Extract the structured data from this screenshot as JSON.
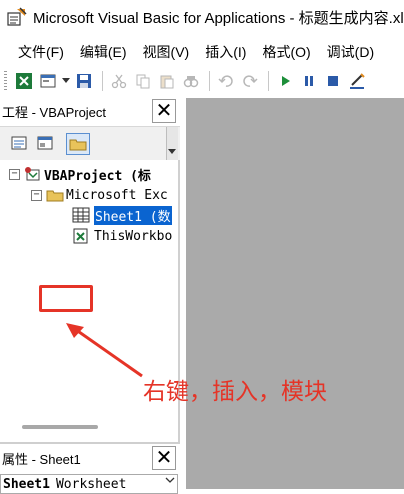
{
  "window": {
    "title": "Microsoft Visual Basic for Applications - 标题生成内容.xlsm"
  },
  "menu": {
    "items": [
      "文件(F)",
      "编辑(E)",
      "视图(V)",
      "插入(I)",
      "格式(O)",
      "调试(D)"
    ]
  },
  "toolbar": {
    "icons": [
      "excel-icon",
      "insert-form-icon",
      "dropdown-arrow-icon",
      "save-icon",
      "cut-icon",
      "copy-icon",
      "paste-icon",
      "find-icon",
      "undo-icon",
      "redo-icon",
      "run-icon",
      "break-icon",
      "reset-icon",
      "design-mode-icon"
    ]
  },
  "project_panel": {
    "title": "工程 - VBAProject",
    "close_label": "✕",
    "tree": {
      "root": {
        "label": "VBAProject (标",
        "expander": "−"
      },
      "folder": {
        "label": "Microsoft Exc",
        "expander": "−"
      },
      "items": [
        {
          "label": "Sheet1 (数",
          "selected": true
        },
        {
          "label": "ThisWorkbo",
          "selected": false
        }
      ]
    }
  },
  "properties_panel": {
    "title": "属性 - Sheet1",
    "close_label": "✕",
    "selected_object": "Sheet1",
    "selected_type": "Worksheet"
  },
  "annotation": {
    "text": "右键，插入，模块",
    "color": "#e53427"
  },
  "colors": {
    "selection": "#0a64d0",
    "code_background": "#aaaaaa"
  }
}
